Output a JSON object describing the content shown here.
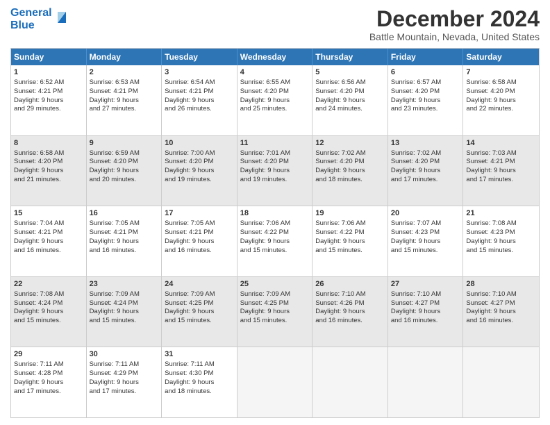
{
  "header": {
    "logo_line1": "General",
    "logo_line2": "Blue",
    "title": "December 2024",
    "subtitle": "Battle Mountain, Nevada, United States"
  },
  "calendar": {
    "days_of_week": [
      "Sunday",
      "Monday",
      "Tuesday",
      "Wednesday",
      "Thursday",
      "Friday",
      "Saturday"
    ],
    "weeks": [
      [
        {
          "day": "",
          "info": "",
          "empty": true
        },
        {
          "day": "2",
          "info": "Sunrise: 6:53 AM\nSunset: 4:21 PM\nDaylight: 9 hours\nand 27 minutes."
        },
        {
          "day": "3",
          "info": "Sunrise: 6:54 AM\nSunset: 4:21 PM\nDaylight: 9 hours\nand 26 minutes."
        },
        {
          "day": "4",
          "info": "Sunrise: 6:55 AM\nSunset: 4:20 PM\nDaylight: 9 hours\nand 25 minutes."
        },
        {
          "day": "5",
          "info": "Sunrise: 6:56 AM\nSunset: 4:20 PM\nDaylight: 9 hours\nand 24 minutes."
        },
        {
          "day": "6",
          "info": "Sunrise: 6:57 AM\nSunset: 4:20 PM\nDaylight: 9 hours\nand 23 minutes."
        },
        {
          "day": "7",
          "info": "Sunrise: 6:58 AM\nSunset: 4:20 PM\nDaylight: 9 hours\nand 22 minutes."
        }
      ],
      [
        {
          "day": "8",
          "info": "Sunrise: 6:58 AM\nSunset: 4:20 PM\nDaylight: 9 hours\nand 21 minutes.",
          "shaded": true
        },
        {
          "day": "9",
          "info": "Sunrise: 6:59 AM\nSunset: 4:20 PM\nDaylight: 9 hours\nand 20 minutes.",
          "shaded": true
        },
        {
          "day": "10",
          "info": "Sunrise: 7:00 AM\nSunset: 4:20 PM\nDaylight: 9 hours\nand 19 minutes.",
          "shaded": true
        },
        {
          "day": "11",
          "info": "Sunrise: 7:01 AM\nSunset: 4:20 PM\nDaylight: 9 hours\nand 19 minutes.",
          "shaded": true
        },
        {
          "day": "12",
          "info": "Sunrise: 7:02 AM\nSunset: 4:20 PM\nDaylight: 9 hours\nand 18 minutes.",
          "shaded": true
        },
        {
          "day": "13",
          "info": "Sunrise: 7:02 AM\nSunset: 4:20 PM\nDaylight: 9 hours\nand 17 minutes.",
          "shaded": true
        },
        {
          "day": "14",
          "info": "Sunrise: 7:03 AM\nSunset: 4:21 PM\nDaylight: 9 hours\nand 17 minutes.",
          "shaded": true
        }
      ],
      [
        {
          "day": "15",
          "info": "Sunrise: 7:04 AM\nSunset: 4:21 PM\nDaylight: 9 hours\nand 16 minutes."
        },
        {
          "day": "16",
          "info": "Sunrise: 7:05 AM\nSunset: 4:21 PM\nDaylight: 9 hours\nand 16 minutes."
        },
        {
          "day": "17",
          "info": "Sunrise: 7:05 AM\nSunset: 4:21 PM\nDaylight: 9 hours\nand 16 minutes."
        },
        {
          "day": "18",
          "info": "Sunrise: 7:06 AM\nSunset: 4:22 PM\nDaylight: 9 hours\nand 15 minutes."
        },
        {
          "day": "19",
          "info": "Sunrise: 7:06 AM\nSunset: 4:22 PM\nDaylight: 9 hours\nand 15 minutes."
        },
        {
          "day": "20",
          "info": "Sunrise: 7:07 AM\nSunset: 4:23 PM\nDaylight: 9 hours\nand 15 minutes."
        },
        {
          "day": "21",
          "info": "Sunrise: 7:08 AM\nSunset: 4:23 PM\nDaylight: 9 hours\nand 15 minutes."
        }
      ],
      [
        {
          "day": "22",
          "info": "Sunrise: 7:08 AM\nSunset: 4:24 PM\nDaylight: 9 hours\nand 15 minutes.",
          "shaded": true
        },
        {
          "day": "23",
          "info": "Sunrise: 7:09 AM\nSunset: 4:24 PM\nDaylight: 9 hours\nand 15 minutes.",
          "shaded": true
        },
        {
          "day": "24",
          "info": "Sunrise: 7:09 AM\nSunset: 4:25 PM\nDaylight: 9 hours\nand 15 minutes.",
          "shaded": true
        },
        {
          "day": "25",
          "info": "Sunrise: 7:09 AM\nSunset: 4:25 PM\nDaylight: 9 hours\nand 15 minutes.",
          "shaded": true
        },
        {
          "day": "26",
          "info": "Sunrise: 7:10 AM\nSunset: 4:26 PM\nDaylight: 9 hours\nand 16 minutes.",
          "shaded": true
        },
        {
          "day": "27",
          "info": "Sunrise: 7:10 AM\nSunset: 4:27 PM\nDaylight: 9 hours\nand 16 minutes.",
          "shaded": true
        },
        {
          "day": "28",
          "info": "Sunrise: 7:10 AM\nSunset: 4:27 PM\nDaylight: 9 hours\nand 16 minutes.",
          "shaded": true
        }
      ],
      [
        {
          "day": "29",
          "info": "Sunrise: 7:11 AM\nSunset: 4:28 PM\nDaylight: 9 hours\nand 17 minutes."
        },
        {
          "day": "30",
          "info": "Sunrise: 7:11 AM\nSunset: 4:29 PM\nDaylight: 9 hours\nand 17 minutes."
        },
        {
          "day": "31",
          "info": "Sunrise: 7:11 AM\nSunset: 4:30 PM\nDaylight: 9 hours\nand 18 minutes."
        },
        {
          "day": "",
          "info": "",
          "empty": true
        },
        {
          "day": "",
          "info": "",
          "empty": true
        },
        {
          "day": "",
          "info": "",
          "empty": true
        },
        {
          "day": "",
          "info": "",
          "empty": true
        }
      ]
    ],
    "week1_day1": {
      "day": "1",
      "info": "Sunrise: 6:52 AM\nSunset: 4:21 PM\nDaylight: 9 hours\nand 29 minutes."
    }
  }
}
